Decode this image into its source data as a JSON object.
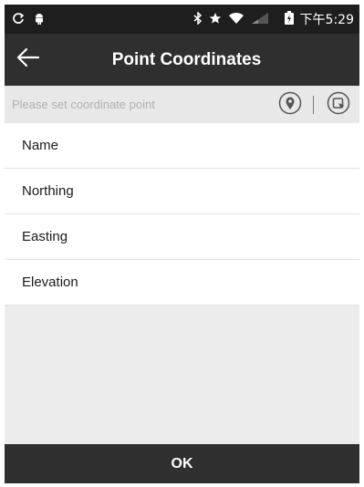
{
  "status_bar": {
    "icons_left": [
      "sync-icon",
      "android-icon"
    ],
    "icons_right": [
      "bluetooth-icon",
      "star-icon",
      "wifi-icon",
      "signal-icon",
      "battery-icon"
    ],
    "time": "下午5:29"
  },
  "header": {
    "back_icon": "arrow-left-icon",
    "title": "Point Coordinates"
  },
  "set_point": {
    "placeholder": "Please set coordinate point",
    "location_button_icon": "map-pin-icon",
    "pick_button_icon": "select-from-list-icon"
  },
  "fields": [
    {
      "label": "Name"
    },
    {
      "label": "Northing"
    },
    {
      "label": "Easting"
    },
    {
      "label": "Elevation"
    }
  ],
  "footer": {
    "ok_label": "OK"
  },
  "colors": {
    "status_bar_bg": "#1e1e1e",
    "toolbar_bg": "#2f2f2f",
    "set_bar_bg": "#e8e8e8",
    "content_bg": "#ececec",
    "placeholder_text": "#b0b0b0"
  }
}
